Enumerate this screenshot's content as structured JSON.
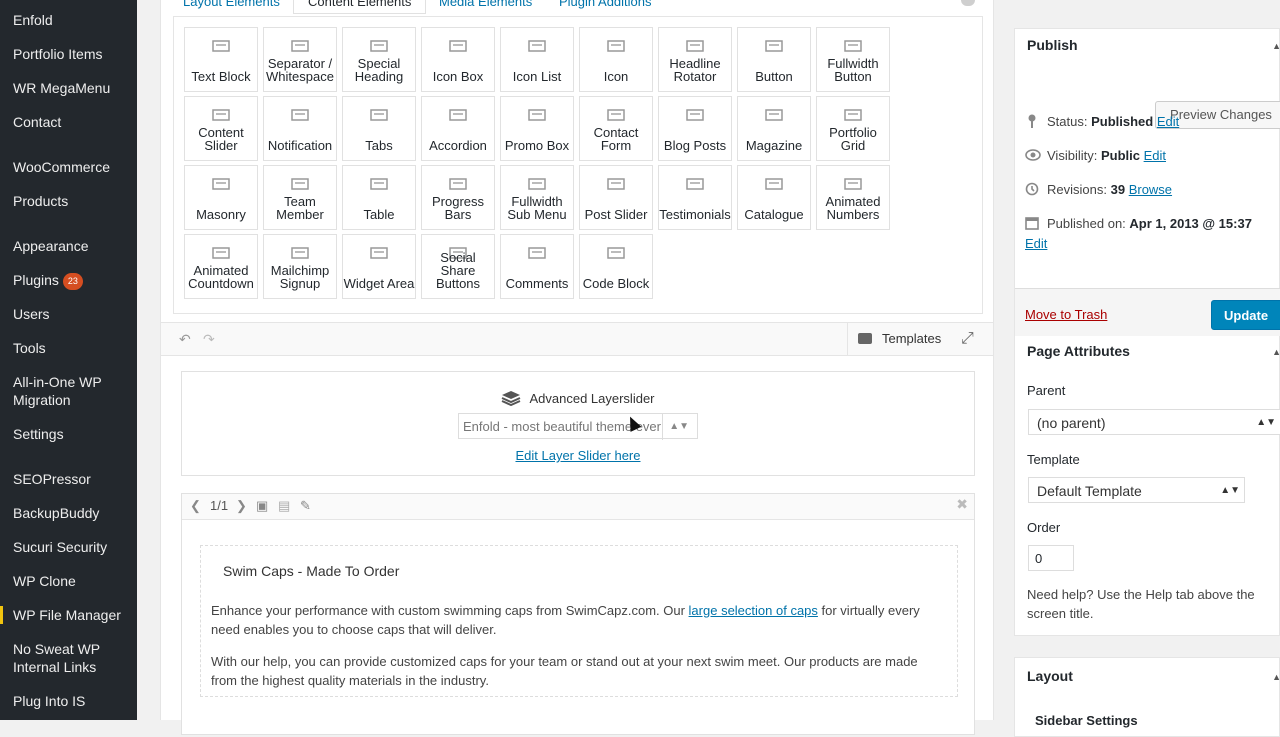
{
  "sidebar": {
    "items": [
      {
        "label": "Enfold"
      },
      {
        "label": "Portfolio Items"
      },
      {
        "label": "WR MegaMenu"
      },
      {
        "label": "Contact"
      },
      {
        "label": "WooCommerce"
      },
      {
        "label": "Products"
      },
      {
        "label": "Appearance"
      },
      {
        "label": "Plugins",
        "badge": "23"
      },
      {
        "label": "Users"
      },
      {
        "label": "Tools"
      },
      {
        "label": "All-in-One WP Migration"
      },
      {
        "label": "Settings"
      },
      {
        "label": "SEOPressor"
      },
      {
        "label": "BackupBuddy"
      },
      {
        "label": "Sucuri Security"
      },
      {
        "label": "WP Clone"
      },
      {
        "label": "WP File Manager"
      },
      {
        "label": "No Sweat WP Internal Links"
      },
      {
        "label": "Plug Into IS"
      }
    ]
  },
  "builder": {
    "tabs": [
      "Layout Elements",
      "Content Elements",
      "Media Elements",
      "Plugin Additions"
    ],
    "elements": [
      "Text Block",
      "Separator / Whitespace",
      "Special Heading",
      "Icon Box",
      "Icon List",
      "Icon",
      "Headline Rotator",
      "Button",
      "Fullwidth Button",
      "Content Slider",
      "Notification",
      "Tabs",
      "Accordion",
      "Promo Box",
      "Contact Form",
      "Blog Posts",
      "Magazine",
      "Portfolio Grid",
      "Masonry",
      "Team Member",
      "Table",
      "Progress Bars",
      "Fullwidth Sub Menu",
      "Post Slider",
      "Testimonials",
      "Catalogue",
      "Animated Numbers",
      "Animated Countdown",
      "Mailchimp Signup",
      "Widget Area",
      "Social Share Buttons",
      "Comments",
      "Code Block"
    ],
    "templates_label": "Templates"
  },
  "layerslider": {
    "title": "Advanced Layerslider",
    "selected": "Enfold - most beautiful theme ever",
    "link": "Edit Layer Slider here"
  },
  "textblock": {
    "pager": "1/1",
    "heading": "Swim Caps - Made To Order",
    "p1_before": "Enhance your performance with custom swimming caps from SwimCapz.com. Our ",
    "p1_link": "large selection of caps",
    "p1_after": " for virtually every need enables you to choose caps that will deliver.",
    "p2": "With our help, you can provide customized caps for your team or stand out at your next swim meet. Our products are made from the highest quality materials in the industry."
  },
  "publish": {
    "title": "Publish",
    "preview": "Preview Changes",
    "status_label": "Status:",
    "status_value": "Published",
    "visibility_label": "Visibility:",
    "visibility_value": "Public",
    "revisions_label": "Revisions:",
    "revisions_value": "39",
    "browse": "Browse",
    "published_label": "Published on:",
    "published_value": "Apr 1, 2013 @ 15:37",
    "edit": "Edit",
    "trash": "Move to Trash",
    "update": "Update"
  },
  "attributes": {
    "title": "Page Attributes",
    "parent_label": "Parent",
    "parent_value": "(no parent)",
    "template_label": "Template",
    "template_value": "Default Template",
    "order_label": "Order",
    "order_value": "0",
    "help": "Need help? Use the Help tab above the screen title."
  },
  "layout": {
    "title": "Layout",
    "sidebar_settings": "Sidebar Settings"
  },
  "colors": {
    "sidebar_bg": "#23282d",
    "accent": "#0073aa",
    "update_btn": "#0085ba",
    "badge": "#d54e21"
  }
}
